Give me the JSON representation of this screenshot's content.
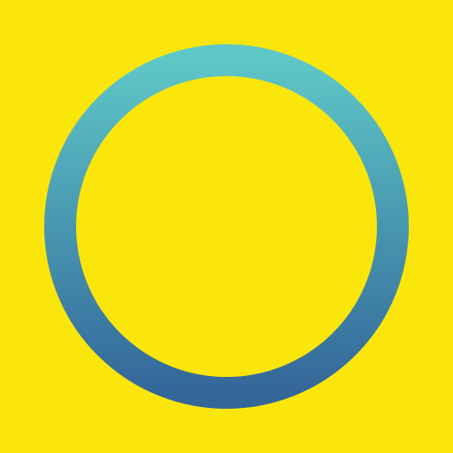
{
  "colors": {
    "background": "#fae60a",
    "ring_top": "#5ec7c7",
    "ring_bottom": "#336699"
  },
  "icons": {
    "ring": "ring-icon"
  }
}
